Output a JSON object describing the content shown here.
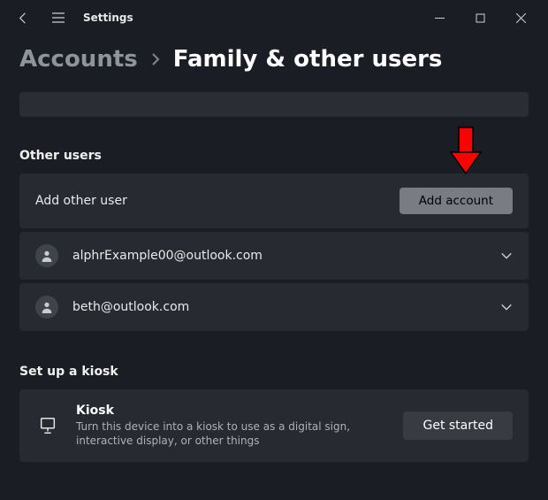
{
  "titlebar": {
    "title": "Settings"
  },
  "breadcrumb": {
    "parent": "Accounts",
    "current": "Family & other users"
  },
  "sections": {
    "other_users": {
      "heading": "Other users",
      "add_label": "Add other user",
      "add_button": "Add account",
      "users": [
        {
          "email": "alphrExample00@outlook.com"
        },
        {
          "email": "beth@outlook.com"
        }
      ]
    },
    "kiosk": {
      "heading": "Set up a kiosk",
      "title": "Kiosk",
      "description": "Turn this device into a kiosk to use as a digital sign, interactive display, or other things",
      "button": "Get started"
    }
  }
}
